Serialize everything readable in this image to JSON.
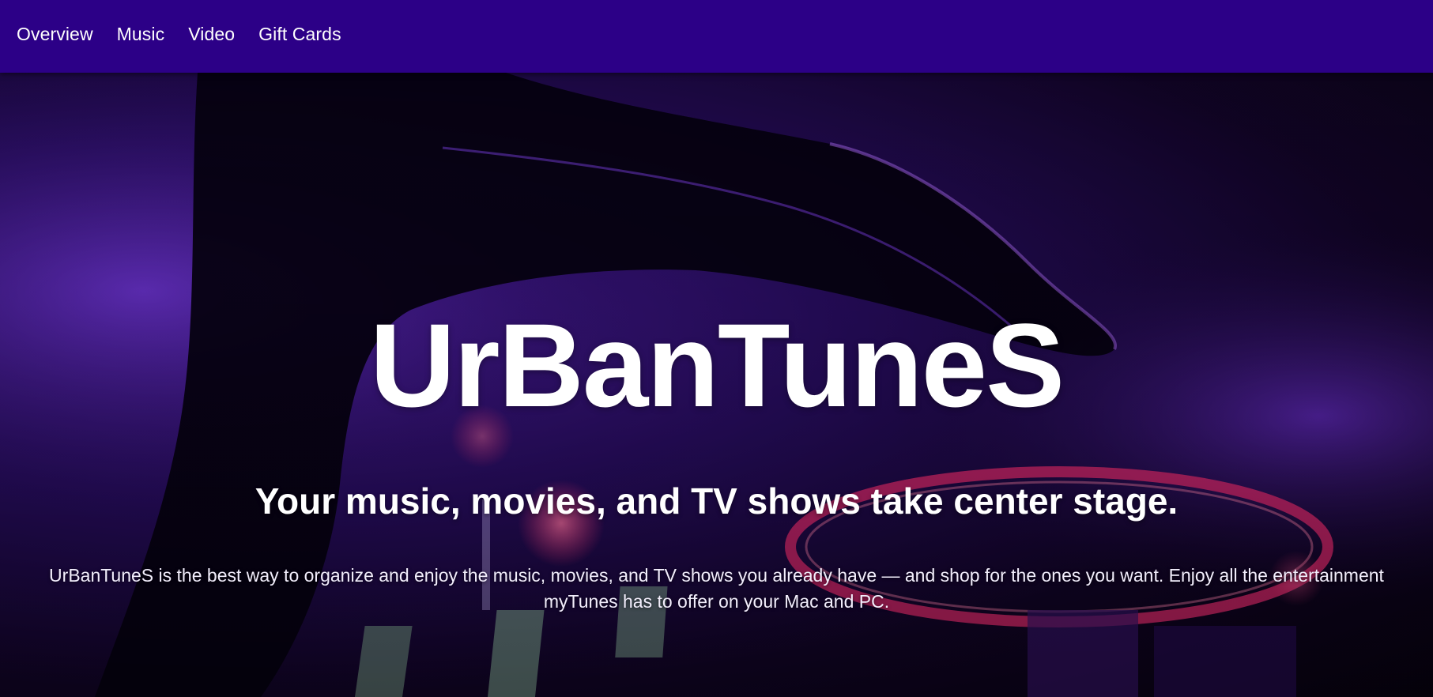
{
  "nav": {
    "items": [
      {
        "label": "Overview"
      },
      {
        "label": "Music"
      },
      {
        "label": "Video"
      },
      {
        "label": "Gift Cards"
      }
    ],
    "background_color": "#2c0087"
  },
  "hero": {
    "title": "UrBanTuneS",
    "subtitle": "Your music, movies, and TV shows take center stage.",
    "description": "UrBanTuneS is the best way to organize and enjoy the music, movies, and TV shows you already have — and shop for the ones you want. Enjoy all the entertainment myTunes has to offer on your Mac and PC.",
    "background_image": "dj-turntable-hand-photo",
    "accent_colors": [
      "#5a22c9",
      "#ff2e7a",
      "#3a0f8a",
      "#b04dff"
    ]
  }
}
